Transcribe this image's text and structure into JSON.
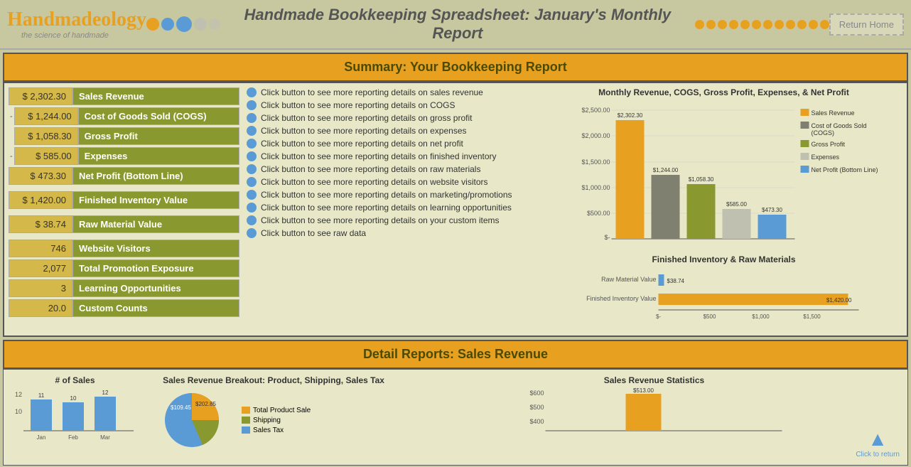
{
  "header": {
    "logo_handmade": "Handmade",
    "logo_ology": "ology",
    "logo_sub": "the science of handmade",
    "title": "Handmade Bookkeeping Spreadsheet:  January's Monthly Report",
    "return_home": "Return Home"
  },
  "summary": {
    "section_title": "Summary:  Your Bookkeeping Report",
    "rows": [
      {
        "value": "$ 2,302.30",
        "label": "Sales Revenue"
      },
      {
        "value": "$ 1,244.00",
        "label": "Cost of Goods Sold (COGS)"
      },
      {
        "value": "$ 1,058.30",
        "label": "Gross Profit"
      },
      {
        "value": "$  585.00",
        "label": "Expenses"
      },
      {
        "value": "$  473.30",
        "label": "Net Profit (Bottom Line)"
      }
    ],
    "rows2": [
      {
        "value": "$ 1,420.00",
        "label": "Finished Inventory Value"
      },
      {
        "value": "$   38.74",
        "label": "Raw Material Value"
      },
      {
        "value": "746",
        "label": "Website Visitors"
      },
      {
        "value": "2,077",
        "label": "Total Promotion Exposure"
      },
      {
        "value": "3",
        "label": "Learning Opportunities"
      },
      {
        "value": "20.0",
        "label": "Custom Counts"
      }
    ],
    "buttons": [
      "Click button to see more reporting details on sales revenue",
      "Click button to see more reporting details on COGS",
      "Click button to see more reporting details on gross profit",
      "Click button to see more reporting details on expenses",
      "Click button to see more reporting details on net profit",
      "Click button to see more reporting details on finished inventory",
      "Click button to see more reporting details on raw materials",
      "Click button to see more reporting details on website visitors",
      "Click button to see more reporting details on marketing/promotions",
      "Click button to see more reporting details on learning opportunities",
      "Click button to see more reporting details on your custom items",
      "Click button to see raw data"
    ]
  },
  "chart": {
    "title": "Monthly Revenue, COGS, Gross Profit, Expenses, & Net Profit",
    "bars": [
      {
        "label": "Sales Revenue",
        "value": 2302.3,
        "display": "$2,302.30",
        "color": "#e8a020"
      },
      {
        "label": "COGS",
        "value": 1244.0,
        "display": "$1,244.00",
        "color": "#808070"
      },
      {
        "label": "Gross Profit",
        "value": 1058.3,
        "display": "$1,058.30",
        "color": "#8a9830"
      },
      {
        "label": "Expenses",
        "value": 585.0,
        "display": "$585.00",
        "color": "#c0c0b0"
      },
      {
        "label": "Net Profit",
        "value": 473.3,
        "display": "$473.30",
        "color": "#5b9bd5"
      }
    ],
    "y_max": 2500,
    "y_labels": [
      "$2,500.00",
      "$2,000.00",
      "$1,500.00",
      "$1,000.00",
      "$500.00",
      "$-"
    ],
    "legend": [
      {
        "label": "Sales Revenue",
        "color": "#e8a020"
      },
      {
        "label": "Cost of Goods Sold (COGS)",
        "color": "#808070"
      },
      {
        "label": "Gross Profit",
        "color": "#8a9830"
      },
      {
        "label": "Expenses",
        "color": "#c0c0b0"
      },
      {
        "label": "Net Profit (Bottom Line)",
        "color": "#5b9bd5"
      }
    ]
  },
  "horiz_chart": {
    "title": "Finished  Inventory & Raw Materials",
    "rows": [
      {
        "label": "Raw Material Value",
        "value": 38.74,
        "display": "$38.74",
        "color": "#5b9bd5",
        "max": 1500
      },
      {
        "label": "Finished Inventory Value",
        "value": 1420.0,
        "display": "$1,420.00",
        "color": "#e8a020",
        "max": 1500
      }
    ],
    "x_labels": [
      "$-",
      "$500",
      "$1,000",
      "$1,500"
    ]
  },
  "detail": {
    "section_title": "Detail Reports:  Sales Revenue",
    "breakout_title": "Sales Revenue Breakout:  Product, Shipping, Sales Tax",
    "stats_title": "Sales Revenue Statistics",
    "sales_count_title": "# of Sales",
    "sales_values": [
      11,
      10,
      12
    ],
    "breakout_values": [
      "$109.45",
      "$202.85"
    ],
    "stats_value": "$513.00",
    "y_labels_count": [
      12,
      10
    ],
    "chart_amounts": [
      "$600",
      "$500",
      "$400"
    ]
  },
  "click_return": {
    "label": "Click to return"
  }
}
